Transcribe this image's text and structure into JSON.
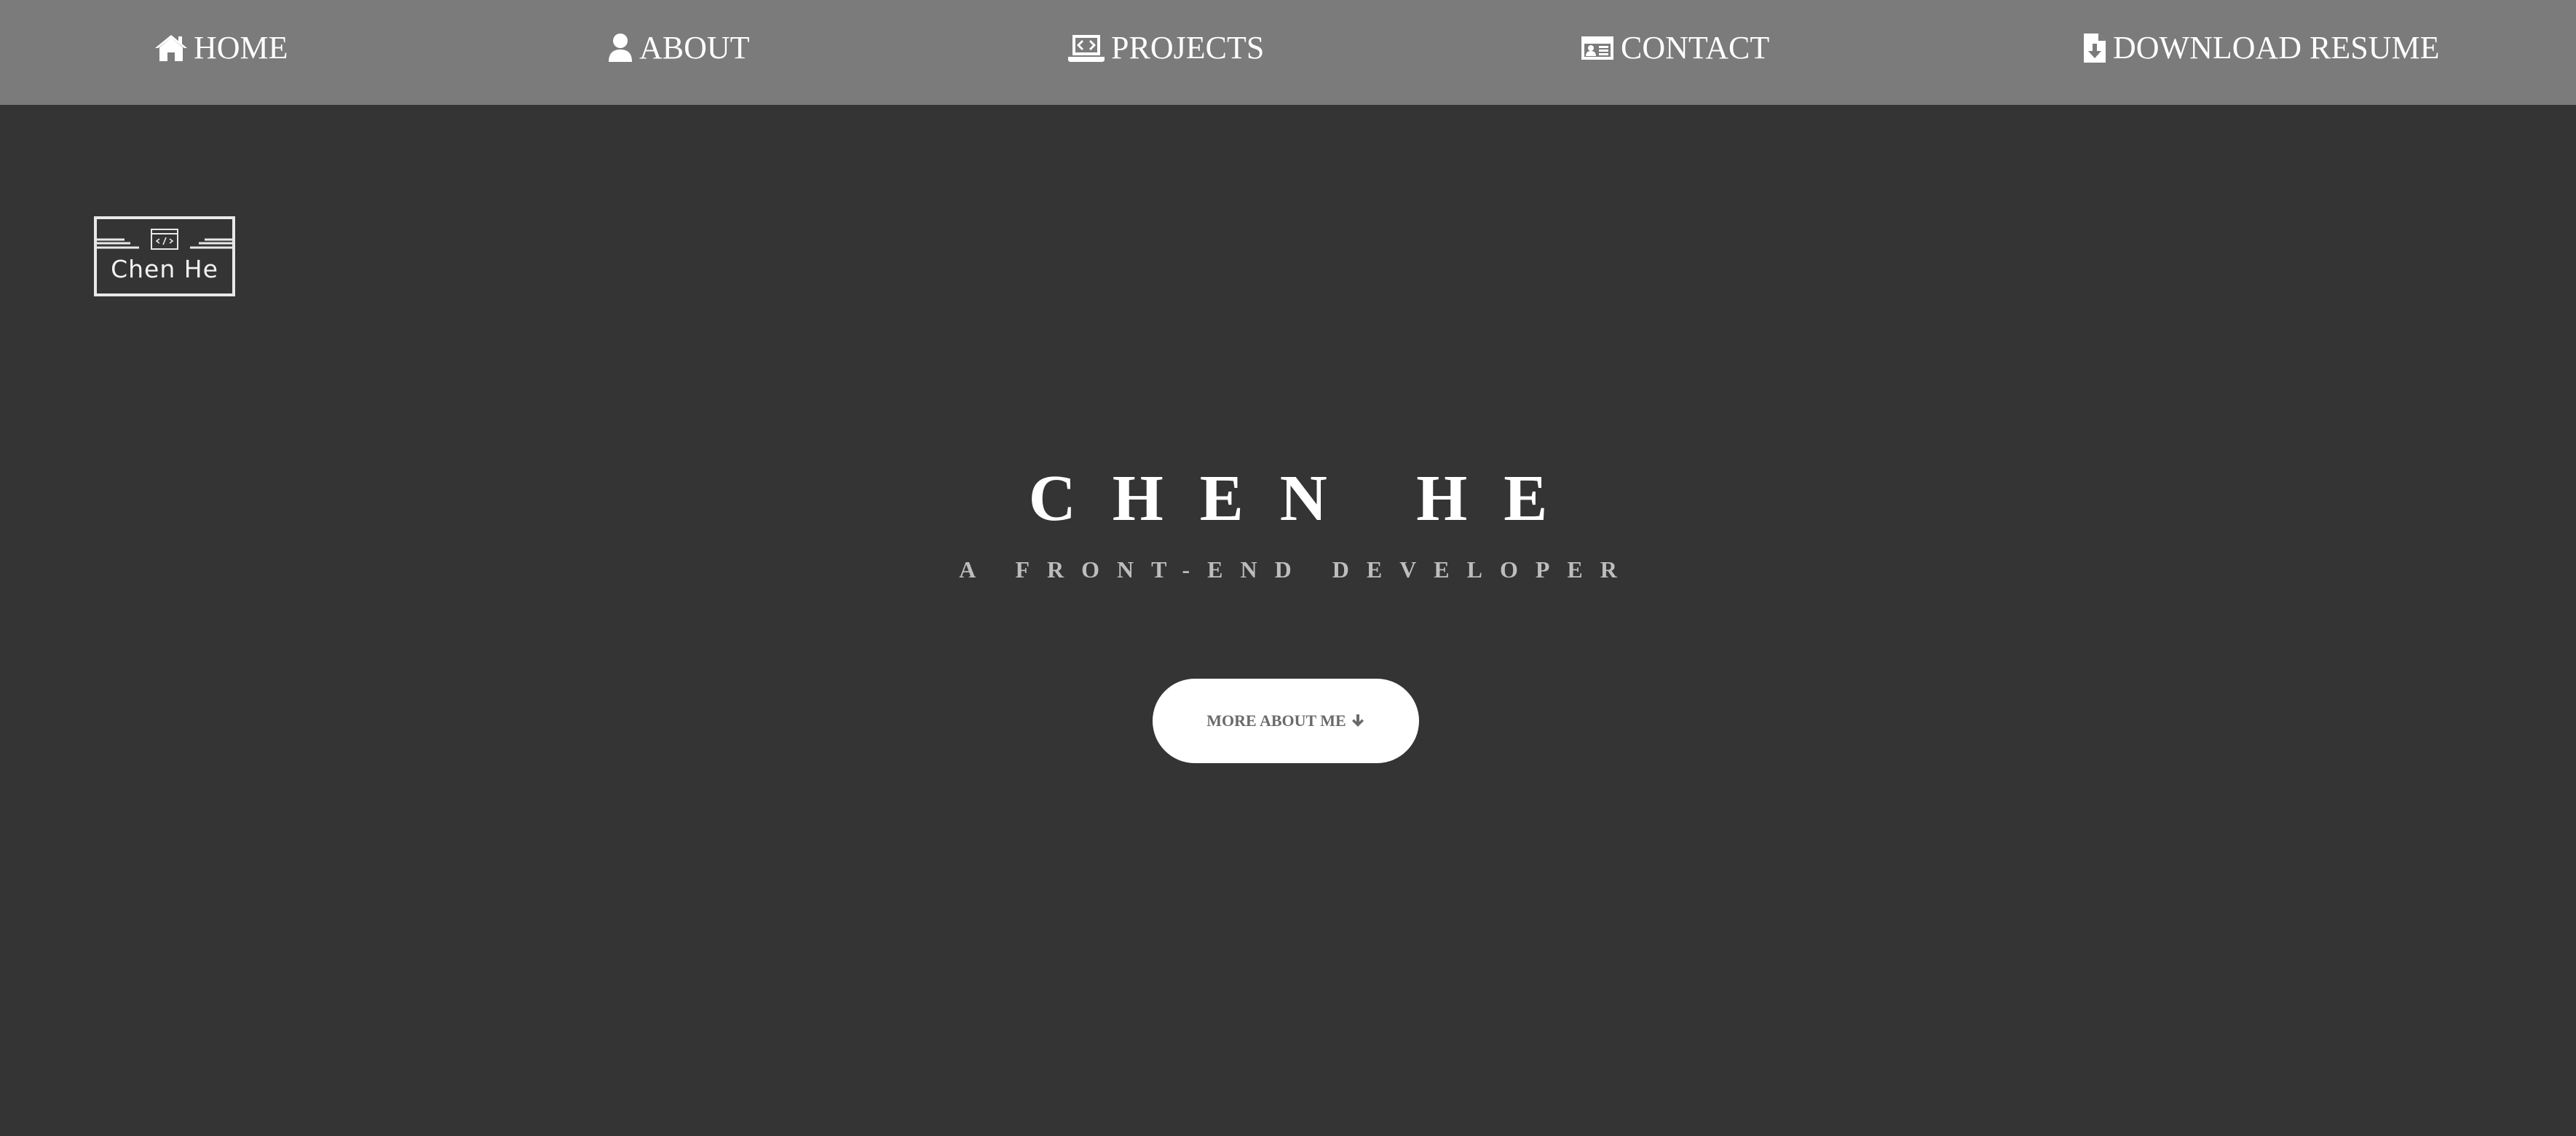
{
  "nav": {
    "items": [
      {
        "label": "HOME",
        "icon": "home-icon"
      },
      {
        "label": "ABOUT",
        "icon": "user-icon"
      },
      {
        "label": "PROJECTS",
        "icon": "laptop-code-icon"
      },
      {
        "label": "CONTACT",
        "icon": "id-card-icon"
      },
      {
        "label": "DOWNLOAD RESUME",
        "icon": "file-download-icon"
      }
    ]
  },
  "logo": {
    "text": "Chen He",
    "icon": "code-window-icon"
  },
  "hero": {
    "title": "CHEN HE",
    "subtitle": "A FRONT-END DEVELOPER",
    "button_label": "MORE ABOUT ME",
    "button_icon": "arrow-down-icon"
  },
  "colors": {
    "background": "#343434",
    "navbar": "#7b7b7b",
    "text": "#ffffff",
    "subtitle": "#bdbdbd",
    "button_bg": "#ffffff",
    "button_text": "#6a6a6a"
  }
}
